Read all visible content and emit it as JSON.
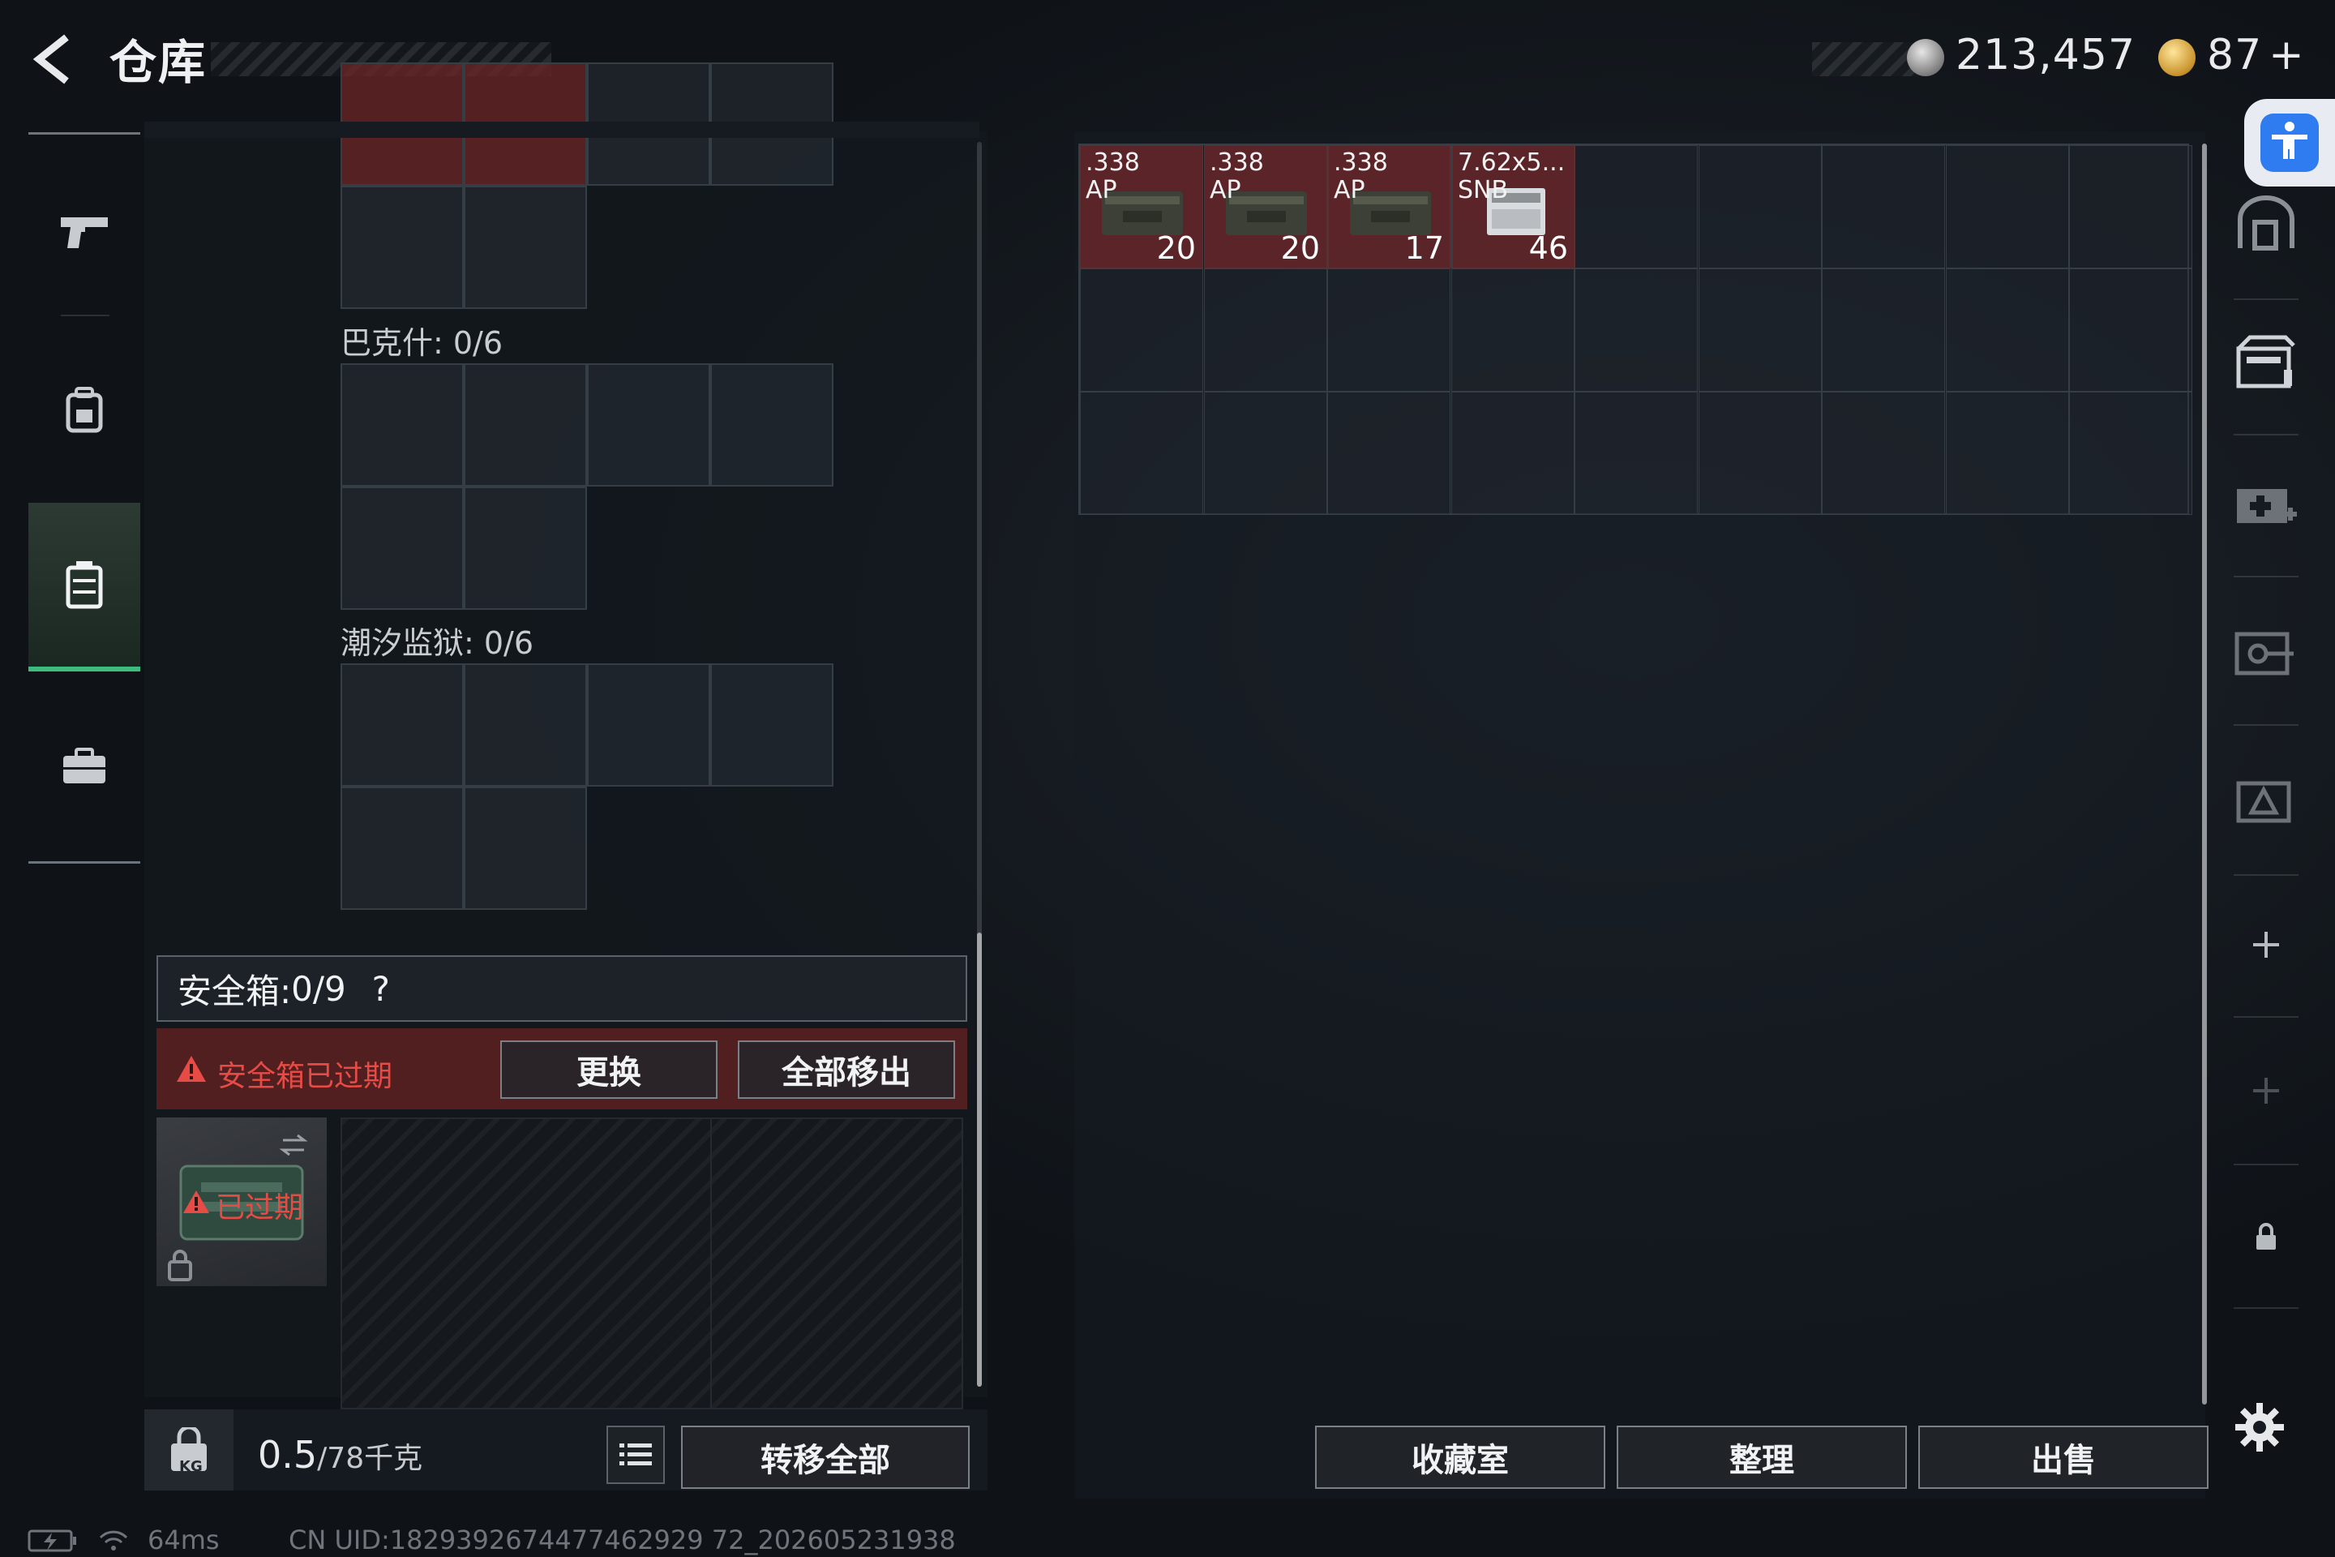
{
  "header": {
    "title": "仓库",
    "currency_silver": "213,457",
    "currency_gold": "87",
    "currency_gold_plus": "+"
  },
  "left_sidebar": {
    "items": [
      {
        "icon": "pistol-icon"
      },
      {
        "icon": "backpack-icon"
      },
      {
        "icon": "vest-icon",
        "active": true
      },
      {
        "icon": "briefcase-icon"
      }
    ]
  },
  "containers": {
    "slot1_label": "巴克什: 0/6",
    "slot2_label": "潮汐监狱: 0/6"
  },
  "safebox": {
    "label": "安全箱: ",
    "count": "0/9",
    "help": "?",
    "warning": "安全箱已过期",
    "replace_button": "更换",
    "remove_all_button": "全部移出",
    "expired_label": "已过期"
  },
  "bottom_left": {
    "weight_value": "0.5",
    "weight_max": "/78千克",
    "lock_badge": "KG",
    "transfer_all_button": "转移全部"
  },
  "stash": {
    "items": [
      {
        "name": ".338\nAP",
        "count": "20"
      },
      {
        "name": ".338\nAP",
        "count": "20"
      },
      {
        "name": ".338\nAP",
        "count": "17"
      },
      {
        "name": "7.62x5...\nSNB",
        "count": "46"
      }
    ]
  },
  "bottom_right": {
    "collection_button": "收藏室",
    "organize_button": "整理",
    "sell_button": "出售"
  },
  "status_bar": {
    "ping": "64ms",
    "uid": "CN UID:1829392674477462929 72_202605231938"
  },
  "colors": {
    "accent_green": "#3dbd7d",
    "warning_red": "#e74b45",
    "item_red": "#692628"
  }
}
